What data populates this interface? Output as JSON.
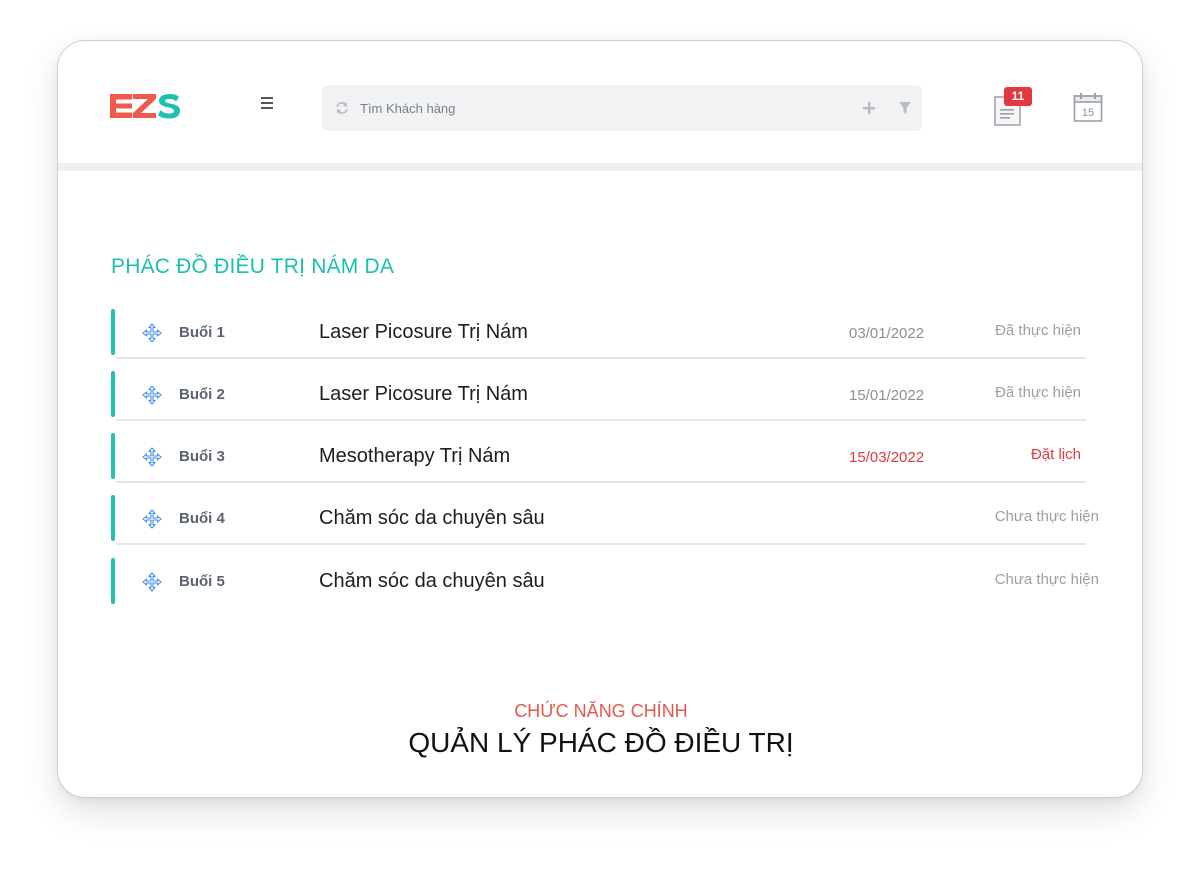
{
  "header": {
    "logo_text": "EZS",
    "search": {
      "placeholder": "Tìm Khách hàng",
      "value": ""
    },
    "notification_count": "11",
    "calendar_day": "15"
  },
  "section": {
    "title": "PHÁC ĐỒ ĐIỀU TRỊ NÁM DA",
    "rows": [
      {
        "session": "Buổi 1",
        "service": "Laser Picosure Trị Nám",
        "date": "03/01/2022",
        "status": "Đã thực hiện"
      },
      {
        "session": "Buổi 2",
        "service": "Laser Picosure Trị Nám",
        "date": "15/01/2022",
        "status": "Đã thực hiện"
      },
      {
        "session": "Buổi 3",
        "service": "Mesotherapy Trị Nám",
        "date": "15/03/2022",
        "status": "Đặt lịch"
      },
      {
        "session": "Buổi 4",
        "service": "Chăm sóc da chuyên sâu",
        "date": "",
        "status": "Chưa thực hiện"
      },
      {
        "session": "Buổi 5",
        "service": "Chăm sóc da chuyên sâu",
        "date": "",
        "status": "Chưa thực hiện"
      }
    ]
  },
  "footer": {
    "subtitle": "CHỨC NĂNG CHÍNH",
    "title": "QUẢN LÝ PHÁC ĐỒ ĐIỀU TRỊ"
  },
  "colors": {
    "accent_teal": "#1fc2b3",
    "title_teal": "#1bbfb0",
    "logo_red": "#ef5a4c",
    "logo_teal": "#1fbfb2",
    "alert_red": "#e0393f",
    "badge_red": "#e2383f"
  },
  "icons": {
    "menu": "hamburger-icon",
    "search_prefix": "refresh-icon",
    "add": "plus-icon",
    "filter": "filter-icon",
    "notifications": "document-icon",
    "calendar": "calendar-icon",
    "row_handle": "move-arrows-icon"
  }
}
